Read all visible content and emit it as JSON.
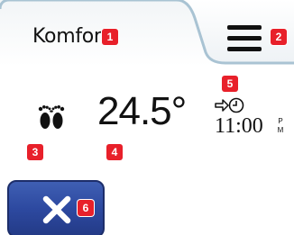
{
  "header": {
    "mode_label": "Komfort",
    "menu_icon": "menu-icon"
  },
  "status": {
    "floor_icon": "bare-feet-icon",
    "temperature": "24.5°",
    "schedule_icon": "next-event-clock-icon",
    "next_event_time": "11:00",
    "ampm_top": "P",
    "ampm_bottom": "M"
  },
  "cancel_button": {
    "icon": "close-icon"
  },
  "badges": [
    "1",
    "2",
    "3",
    "4",
    "5",
    "6"
  ],
  "colors": {
    "badge": "#e8202a",
    "button_blue": "#2d49a0",
    "tab_border": "#a9c3d3",
    "text": "#111111"
  }
}
